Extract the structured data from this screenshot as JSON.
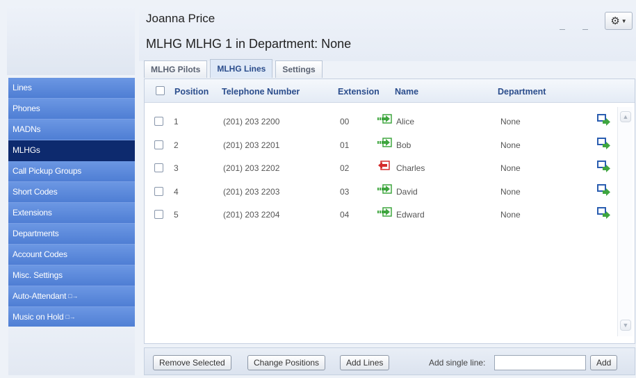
{
  "header": {
    "user_name": "Joanna Price",
    "page_title": "MLHG MLHG 1 in Department: None"
  },
  "tabs": [
    {
      "label": "MLHG Pilots",
      "active": false
    },
    {
      "label": "MLHG Lines",
      "active": true
    },
    {
      "label": "Settings",
      "active": false
    }
  ],
  "sidebar": {
    "items": [
      {
        "label": "Lines",
        "active": false,
        "ext": ""
      },
      {
        "label": "Phones",
        "active": false,
        "ext": ""
      },
      {
        "label": "MADNs",
        "active": false,
        "ext": ""
      },
      {
        "label": "MLHGs",
        "active": true,
        "ext": ""
      },
      {
        "label": "Call Pickup Groups",
        "active": false,
        "ext": ""
      },
      {
        "label": "Short Codes",
        "active": false,
        "ext": ""
      },
      {
        "label": "Extensions",
        "active": false,
        "ext": ""
      },
      {
        "label": "Departments",
        "active": false,
        "ext": ""
      },
      {
        "label": "Account Codes",
        "active": false,
        "ext": ""
      },
      {
        "label": "Misc. Settings",
        "active": false,
        "ext": ""
      },
      {
        "label": "Auto-Attendant",
        "active": false,
        "ext": "□→"
      },
      {
        "label": "Music on Hold",
        "active": false,
        "ext": "□→"
      }
    ]
  },
  "table": {
    "columns": {
      "position": "Position",
      "telephone": "Telephone Number",
      "extension": "Extension",
      "name": "Name",
      "department": "Department"
    },
    "rows": [
      {
        "position": "1",
        "telephone": "(201) 203 2200",
        "extension": "00",
        "name": "Alice",
        "department": "None",
        "status": "in"
      },
      {
        "position": "2",
        "telephone": "(201) 203 2201",
        "extension": "01",
        "name": "Bob",
        "department": "None",
        "status": "in"
      },
      {
        "position": "3",
        "telephone": "(201) 203 2202",
        "extension": "02",
        "name": "Charles",
        "department": "None",
        "status": "out"
      },
      {
        "position": "4",
        "telephone": "(201) 203 2203",
        "extension": "03",
        "name": "David",
        "department": "None",
        "status": "in"
      },
      {
        "position": "5",
        "telephone": "(201) 203 2204",
        "extension": "04",
        "name": "Edward",
        "department": "None",
        "status": "in"
      }
    ]
  },
  "footer": {
    "remove_selected": "Remove Selected",
    "change_positions": "Change Positions",
    "add_lines": "Add Lines",
    "add_single_line_label": "Add single line:",
    "add_single_line_value": "",
    "add_button": "Add"
  },
  "icons": {
    "settings": "gear-icon",
    "status_in": "green-arrow-in-icon",
    "status_out": "red-arrow-out-icon",
    "row_action": "blue-arrow-icon"
  },
  "colors": {
    "sidebar": "#5b89db",
    "sidebar_active": "#0d2a6e",
    "header_text": "#2b4d8c",
    "status_in": "#3fa63f",
    "status_out": "#d42b2b"
  }
}
